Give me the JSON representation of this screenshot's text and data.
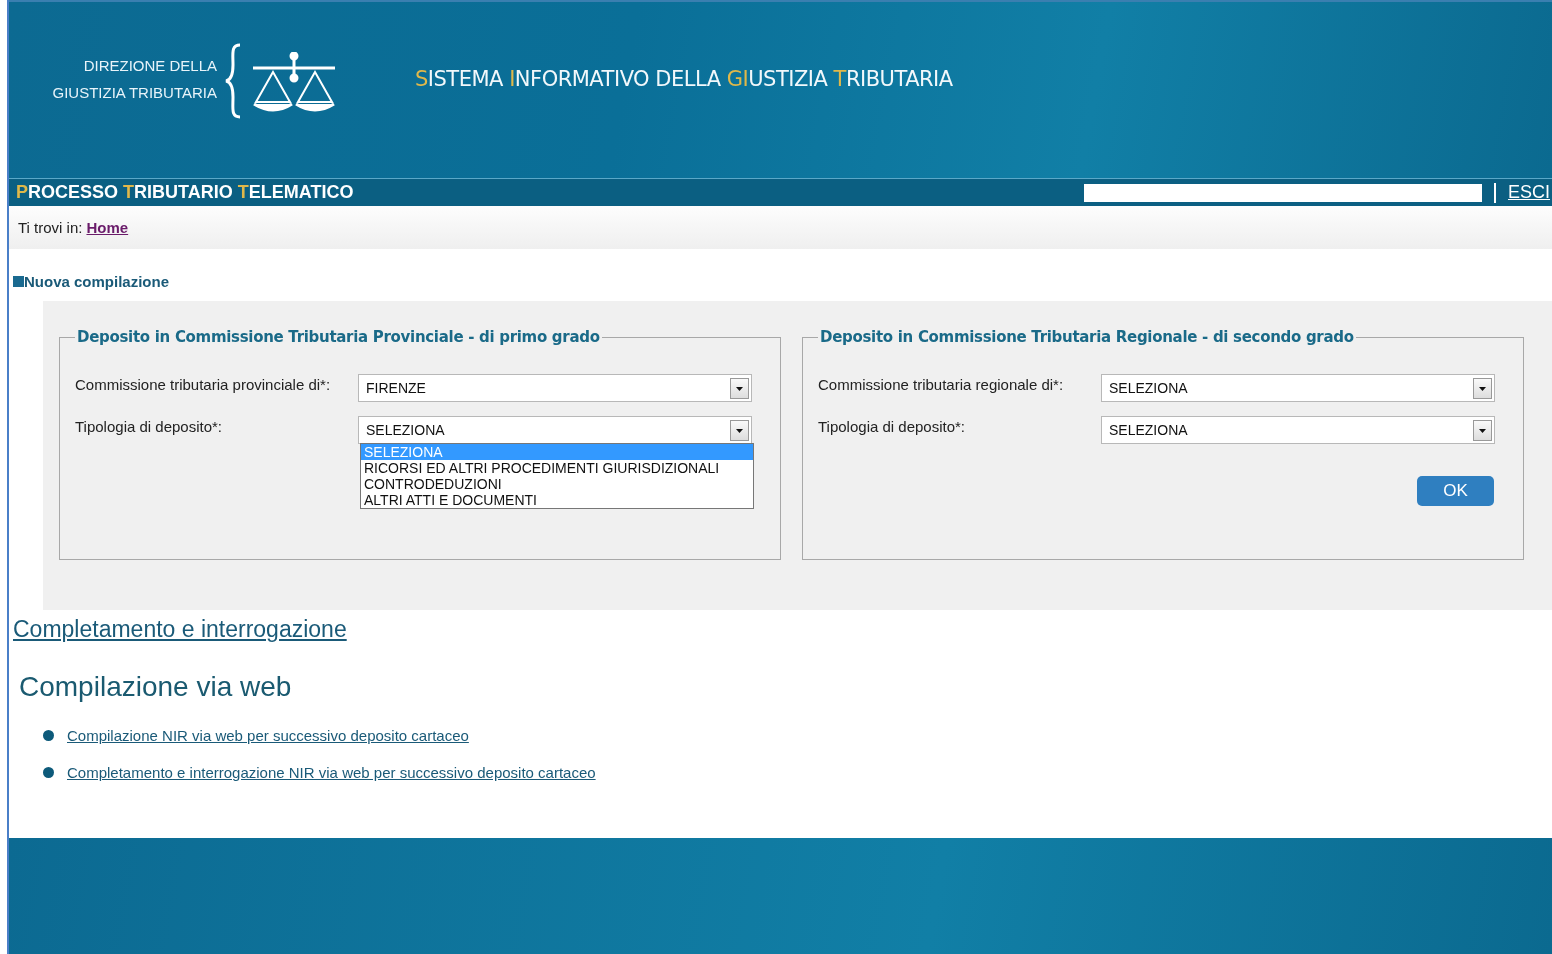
{
  "header": {
    "org_lines": [
      "DIREZIONE DELLA",
      "GIUSTIZIA TRIBUTARIA"
    ],
    "title": [
      {
        "accent": "S",
        "rest": "ISTEMA"
      },
      {
        "accent": "I",
        "rest": "NFORMATIVO"
      },
      {
        "rest": "DELLA"
      },
      {
        "accent": "GI",
        "rest": "USTIZIA"
      },
      {
        "accent": "T",
        "rest": "RIBUTARIA"
      }
    ]
  },
  "nav_bar": {
    "title": [
      {
        "accent": "P",
        "rest": "ROCESSO"
      },
      {
        "accent": "T",
        "rest": "RIBUTARIO"
      },
      {
        "accent": "T",
        "rest": "ELEMATICO"
      }
    ],
    "exit_link": "ESCI"
  },
  "breadcrumb": {
    "label": "Ti trovi in:",
    "link": "Home"
  },
  "section_title": "Nuova compilazione",
  "panels": [
    {
      "legend": "Deposito in Commissione Tributaria Provinciale - di primo grado",
      "fields": [
        {
          "label": "Commissione tributaria provinciale di*:",
          "value": "FIRENZE"
        },
        {
          "label": "Tipologia di deposito*:",
          "value": "SELEZIONA",
          "options": [
            {
              "label": "SELEZIONA",
              "selected": true
            },
            {
              "label": "RICORSI ED ALTRI PROCEDIMENTI GIURISDIZIONALI",
              "selected": false
            },
            {
              "label": "CONTRODEDUZIONI",
              "selected": false
            },
            {
              "label": "ALTRI ATTI E DOCUMENTI",
              "selected": false
            }
          ]
        }
      ]
    },
    {
      "legend": "Deposito in Commissione Tributaria Regionale - di secondo grado",
      "fields": [
        {
          "label": "Commissione tributaria regionale di*:",
          "value": "SELEZIONA"
        },
        {
          "label": "Tipologia di deposito*:",
          "value": "SELEZIONA"
        }
      ],
      "button": "OK"
    }
  ],
  "completion_link": "Completamento e interrogazione",
  "web_heading": "Compilazione via web",
  "web_links": [
    "Compilazione NIR via web per successivo deposito cartaceo",
    "Completamento e interrogazione NIR via web per successivo deposito cartaceo"
  ]
}
